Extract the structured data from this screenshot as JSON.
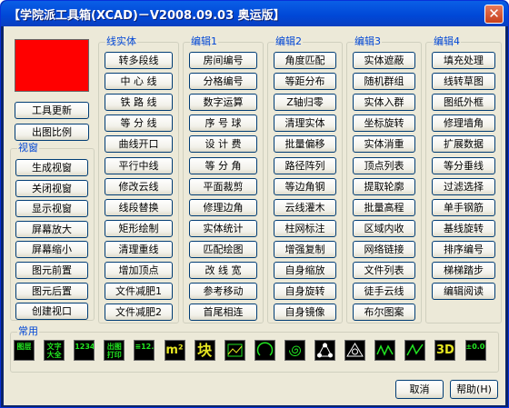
{
  "window": {
    "title": "【学院派工具箱(XCAD)－V2008.09.03 奥运版】",
    "close_label": "✕"
  },
  "left": {
    "update": "工具更新",
    "scale": "出图比例"
  },
  "viewport": {
    "label": "视窗",
    "items": [
      "生成视窗",
      "关闭视窗",
      "显示视窗",
      "屏幕放大",
      "屏幕缩小",
      "图元前置",
      "图元后置",
      "创建视口"
    ]
  },
  "groups": [
    {
      "label": "线实体",
      "items": [
        "转多段线",
        "中 心 线",
        "铁 路 线",
        "等 分 线",
        "曲线开口",
        "平行中线",
        "修改云线",
        "线段替换",
        "矩形绘制",
        "清理重线",
        "增加顶点",
        "文件减肥1",
        "文件减肥2"
      ]
    },
    {
      "label": "编辑1",
      "items": [
        "房间编号",
        "分格编号",
        "数字运算",
        "序 号 球",
        "设 计 费",
        "等 分 角",
        "平面裁剪",
        "修理边角",
        "实体统计",
        "匹配绘图",
        "改 线 宽",
        "参考移动",
        "首尾相连"
      ]
    },
    {
      "label": "编辑2",
      "items": [
        "角度匹配",
        "等距分布",
        "Z轴归零",
        "清理实体",
        "批量偏移",
        "路径阵列",
        "等边角钢",
        "云线灌木",
        "柱网标注",
        "增强复制",
        "自身缩放",
        "自身旋转",
        "自身镜像"
      ]
    },
    {
      "label": "编辑3",
      "items": [
        "实体遮蔽",
        "随机群组",
        "实体入群",
        "坐标旋转",
        "实体消重",
        "顶点列表",
        "提取轮廓",
        "批量高程",
        "区域内收",
        "网络链接",
        "文件列表",
        "徒手云线",
        "布尔图案"
      ]
    },
    {
      "label": "编辑4",
      "items": [
        "填充处理",
        "线转草图",
        "图纸外框",
        "修理墙角",
        "扩展数据",
        "等分垂线",
        "过滤选择",
        "单手钢筋",
        "基线旋转",
        "排序编号",
        "梯梯踏步",
        "编辑阅读"
      ]
    }
  ],
  "common": {
    "label": "常用",
    "icons": [
      {
        "name": "layer-icon",
        "text": "图层"
      },
      {
        "name": "text-library-icon",
        "text": "文字大全"
      },
      {
        "name": "dimension-icon",
        "text": "1234"
      },
      {
        "name": "plot-icon",
        "text": "出图打印"
      },
      {
        "name": "elevation-icon",
        "text": "≡12.7"
      },
      {
        "name": "area-m2-icon",
        "text": "m²"
      },
      {
        "name": "block-icon",
        "text": "块"
      },
      {
        "name": "image-icon",
        "text": ""
      },
      {
        "name": "arc-icon",
        "text": ""
      },
      {
        "name": "spiral-icon",
        "text": ""
      },
      {
        "name": "circles-icon",
        "text": ""
      },
      {
        "name": "triangle-icon",
        "text": ""
      },
      {
        "name": "zigzag-icon",
        "text": ""
      },
      {
        "name": "star-icon",
        "text": ""
      },
      {
        "name": "3d-icon",
        "text": "3D"
      },
      {
        "name": "zero-elevation-icon",
        "text": "±0.00"
      }
    ]
  },
  "footer": {
    "cancel": "取消",
    "help": "帮助(H)"
  }
}
